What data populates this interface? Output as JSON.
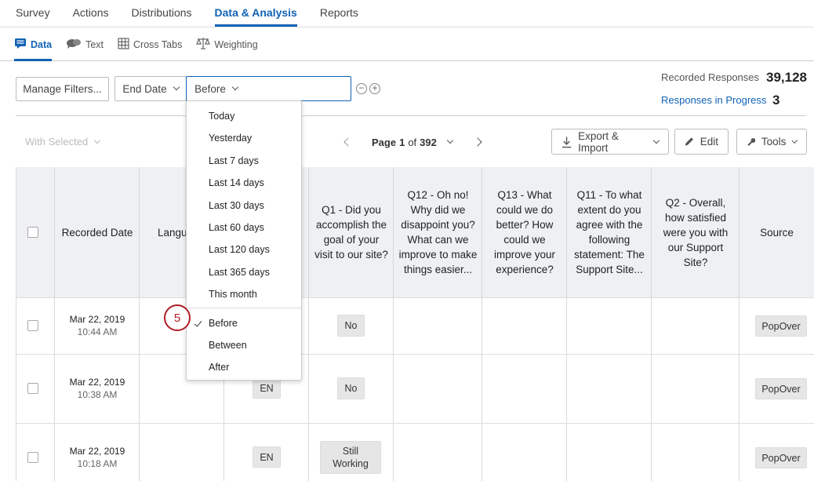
{
  "topnav": {
    "tabs": [
      "Survey",
      "Actions",
      "Distributions",
      "Data & Analysis",
      "Reports"
    ],
    "active": "Data & Analysis"
  },
  "subnav": {
    "tabs": [
      "Data",
      "Text",
      "Cross Tabs",
      "Weighting"
    ],
    "active": "Data"
  },
  "filters": {
    "manage_label": "Manage Filters...",
    "field_label": "End Date",
    "operator_label": "Before",
    "date_value": "",
    "remove_symbol": "−",
    "add_symbol": "+"
  },
  "stats": {
    "recorded_label": "Recorded Responses",
    "recorded_value": "39,128",
    "progress_label": "Responses in Progress",
    "progress_value": "3"
  },
  "toolbar": {
    "with_selected": "With Selected",
    "page_prefix": "Page",
    "page_current": "1",
    "page_of": "of",
    "page_total": "392",
    "export_label": "Export & Import",
    "edit_label": "Edit",
    "tools_label": "Tools"
  },
  "table": {
    "headers": {
      "recorded_date": "Recorded Date",
      "language": "Langu",
      "q1": "Q1 - Did you accomplish the goal of your visit to our site?",
      "q12": "Q12 - Oh no! Why did we disappoint you? What can we improve to make things easier...",
      "q13": "Q13 - What could we do better? How could we improve your experience?",
      "q11": "Q11 - To what extent do you agree with the following statement: The Support Site...",
      "q2": "Q2 - Overall, how satisfied were you with our Support Site?",
      "source": "Source"
    },
    "rows": [
      {
        "date": "Mar 22, 2019",
        "time": "10:44 AM",
        "language": "",
        "q1": "No",
        "source": "PopOver"
      },
      {
        "date": "Mar 22, 2019",
        "time": "10:38 AM",
        "language": "EN",
        "q1": "No",
        "source": "PopOver"
      },
      {
        "date": "Mar 22, 2019",
        "time": "10:18 AM",
        "language": "EN",
        "q1": "Still Working",
        "source": "PopOver"
      }
    ]
  },
  "dropdown": {
    "items": [
      "Today",
      "Yesterday",
      "Last 7 days",
      "Last 14 days",
      "Last 30 days",
      "Last 60 days",
      "Last 120 days",
      "Last 365 days",
      "This month",
      "Before",
      "Between",
      "After"
    ],
    "selected": "Before"
  },
  "callout": {
    "number": "5"
  },
  "colors": {
    "accent": "#1162b5",
    "callout": "#b01c24",
    "header_bg": "#eef0f3"
  }
}
